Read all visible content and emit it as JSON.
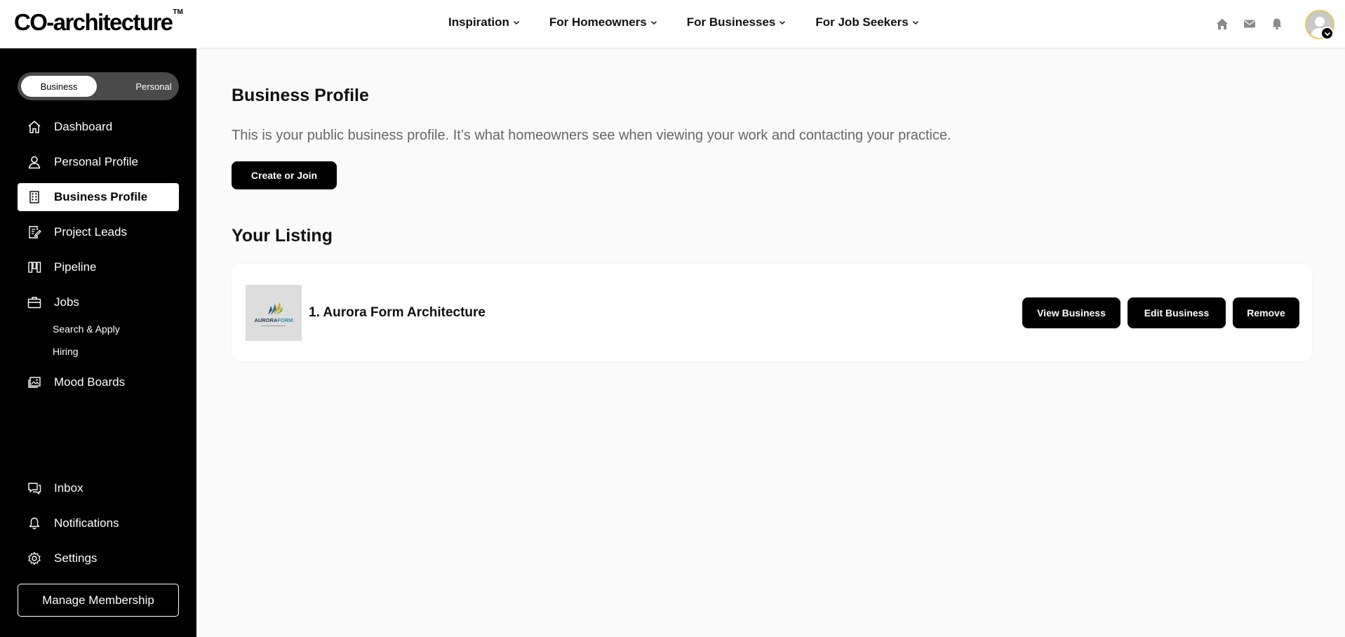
{
  "header": {
    "logo": "CO-architecture",
    "logo_tm": "TM",
    "nav": [
      {
        "label": "Inspiration"
      },
      {
        "label": "For Homeowners"
      },
      {
        "label": "For Businesses"
      },
      {
        "label": "For Job Seekers"
      }
    ],
    "icons": [
      "home-icon",
      "mail-icon",
      "bell-icon",
      "avatar",
      "chevron-down-icon"
    ]
  },
  "sidebar": {
    "toggle": {
      "business": "Business",
      "personal": "Personal",
      "selected": "Business"
    },
    "items": [
      {
        "label": "Dashboard",
        "icon": "home-icon"
      },
      {
        "label": "Personal Profile",
        "icon": "user-icon"
      },
      {
        "label": "Business Profile",
        "icon": "building-icon",
        "active": true
      },
      {
        "label": "Project Leads",
        "icon": "document-edit-icon"
      },
      {
        "label": "Pipeline",
        "icon": "pipeline-icon"
      },
      {
        "label": "Jobs",
        "icon": "briefcase-icon"
      },
      {
        "label": "Mood Boards",
        "icon": "image-gallery-icon"
      }
    ],
    "jobs_sub": [
      "Search & Apply",
      "Hiring"
    ],
    "bottom_items": [
      {
        "label": "Inbox",
        "icon": "chat-icon"
      },
      {
        "label": "Notifications",
        "icon": "bell-icon"
      },
      {
        "label": "Settings",
        "icon": "gear-icon"
      }
    ],
    "manage_membership": "Manage Membership"
  },
  "main": {
    "title": "Business Profile",
    "description": "This is your public business profile. It’s what homeowners see when viewing your work and contacting your practice.",
    "create_button": "Create or Join",
    "listing_title": "Your Listing",
    "listing": {
      "name": "1. Aurora Form Architecture",
      "logo_text_a": "AURORA",
      "logo_text_b": "FORM",
      "buttons": {
        "view": "View Business",
        "edit": "Edit Business",
        "remove": "Remove"
      }
    }
  },
  "colors": {
    "sidebar_bg": "#000000",
    "accent": "#000000",
    "avatar_ring": "#e7c75a",
    "page_bg": "#fafafa"
  }
}
